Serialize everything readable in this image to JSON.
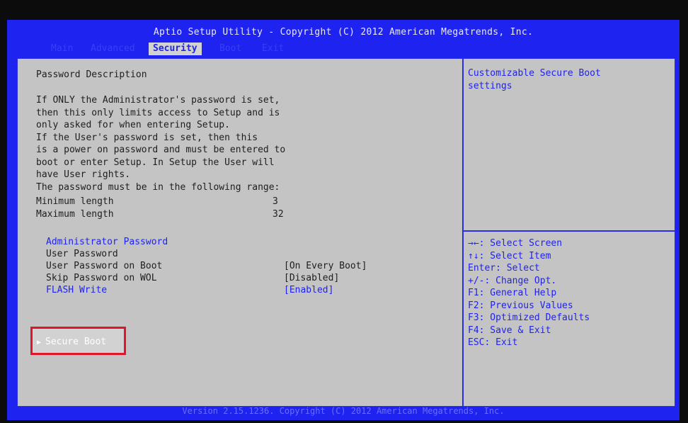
{
  "title": "Aptio Setup Utility - Copyright (C) 2012 American Megatrends, Inc.",
  "tabs": [
    "Main",
    "Advanced",
    "Security",
    "Boot",
    "Exit"
  ],
  "active_tab": "Security",
  "description": {
    "heading": "Password Description",
    "lines": [
      "If ONLY the Administrator's password is set,",
      "then this only limits access to Setup and is",
      "only asked for when entering Setup.",
      "If the User's password is set, then this",
      "is a power on password and must be entered to",
      "boot or enter Setup. In Setup the User will",
      "have User rights.",
      "The password must be in the following range:"
    ],
    "min_label": "Minimum length",
    "min_value": "3",
    "max_label": "Maximum length",
    "max_value": "32"
  },
  "menu": {
    "admin_password": "Administrator Password",
    "user_password": "User Password",
    "user_pw_on_boot_label": "User Password on Boot",
    "user_pw_on_boot_value": "[On Every Boot]",
    "skip_pw_wol_label": "Skip Password on WOL",
    "skip_pw_wol_value": "[Disabled]",
    "flash_write_label": "FLASH Write",
    "flash_write_value": "[Enabled]",
    "secure_boot": "Secure Boot"
  },
  "help_text": "Customizable Secure Boot\nsettings",
  "keys": [
    "→←: Select Screen",
    "↑↓: Select Item",
    "Enter: Select",
    "+/-: Change Opt.",
    "F1: General Help",
    "F2: Previous Values",
    "F3: Optimized Defaults",
    "F4: Save & Exit",
    "ESC: Exit"
  ],
  "footer": "Version 2.15.1236. Copyright (C) 2012 American Megatrends, Inc."
}
